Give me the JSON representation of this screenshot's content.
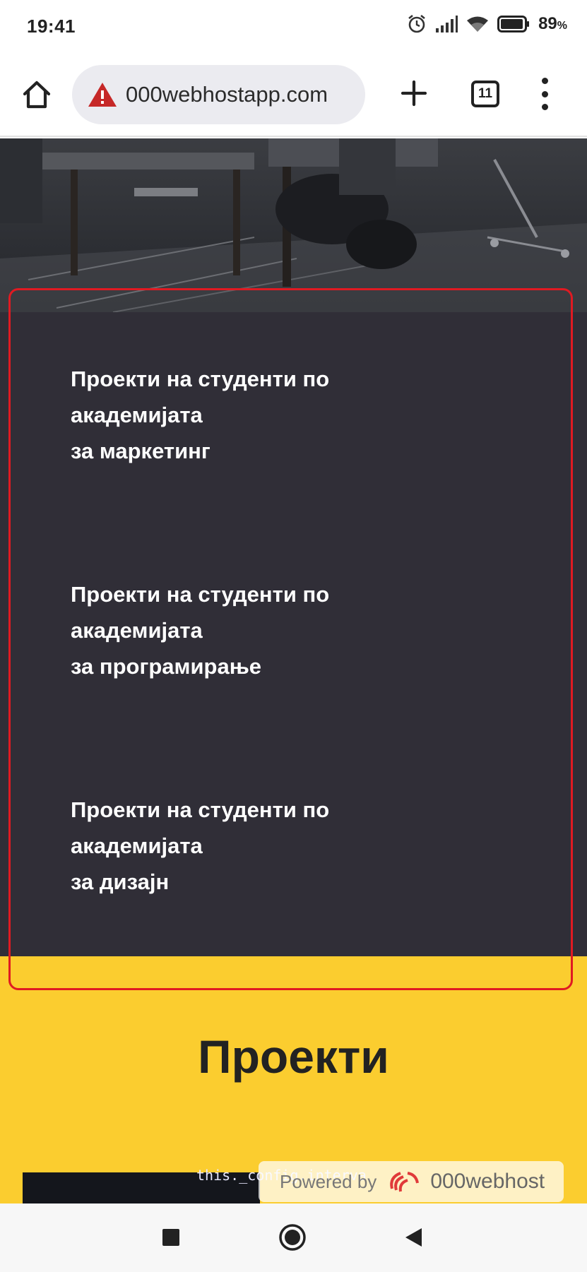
{
  "status_bar": {
    "time": "19:41",
    "battery_percent": "89",
    "battery_unit": "%",
    "icons": [
      "alarm-icon",
      "signal-icon",
      "wifi-icon",
      "battery-icon"
    ]
  },
  "browser": {
    "url": "000webhostapp.com",
    "tab_count": "11",
    "icons": [
      "home-icon",
      "warning-icon",
      "plus-icon",
      "tabs-icon",
      "menu-icon"
    ]
  },
  "content": {
    "academy_links": [
      {
        "line1": "Проекти на студенти по",
        "line2": "академијата",
        "line3": "за маркетинг"
      },
      {
        "line1": "Проекти на студенти по",
        "line2": "академијата",
        "line3": "за програмирање"
      },
      {
        "line1": "Проекти на студенти по",
        "line2": "академијата",
        "line3": "за дизајн"
      }
    ],
    "projects_heading": "Проекти",
    "code_snippet": "this._config.interva",
    "powered_by": {
      "prefix": "Powered by",
      "brand": "000webhost"
    }
  },
  "colors": {
    "dark_section": "#302e37",
    "yellow_section": "#fbcd2f",
    "highlight_border": "#e01a22",
    "warning": "#c62828"
  },
  "nav_bar": {
    "icons": [
      "recents-square-icon",
      "home-circle-icon",
      "back-triangle-icon"
    ]
  }
}
